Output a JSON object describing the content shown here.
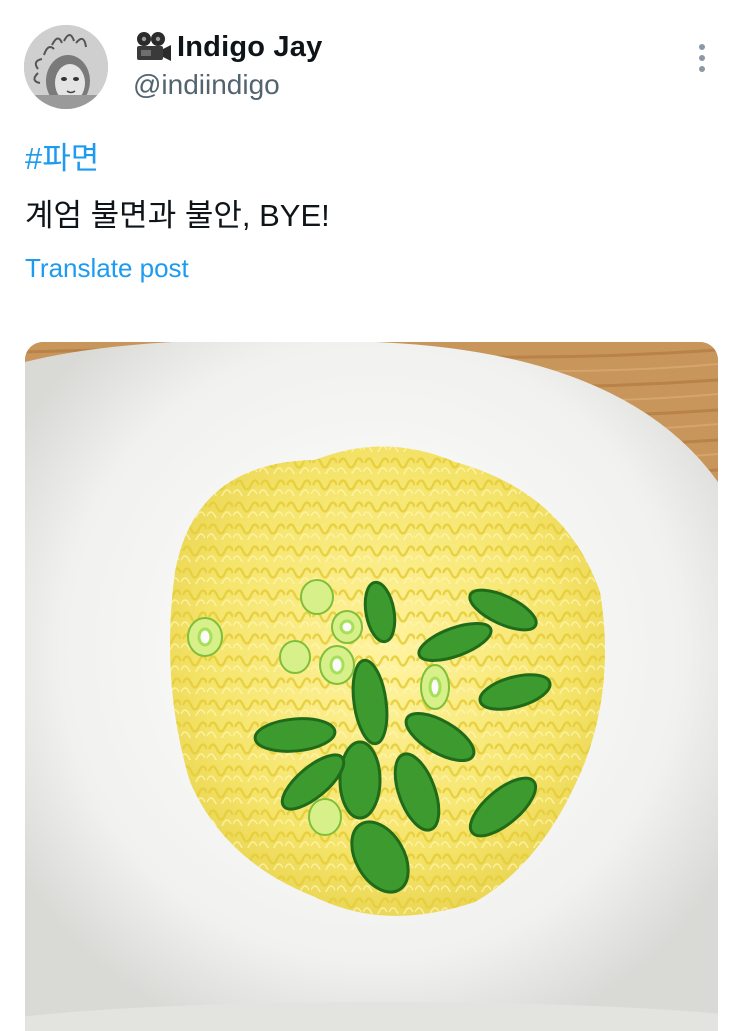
{
  "author": {
    "name": "Indigo Jay",
    "handle": "@indiindigo",
    "avatar_icon": "profile-photo",
    "badge_icon": "film-projector-emoji"
  },
  "post": {
    "hashtag": "#파면",
    "text": "계엄 불면과 불안, BYE!",
    "translate_label": "Translate post"
  },
  "media": {
    "description_icon": "noodle-bowl-photo"
  },
  "colors": {
    "link": "#1d9bf0",
    "secondary_text": "#536471",
    "primary_text": "#0f1419"
  }
}
